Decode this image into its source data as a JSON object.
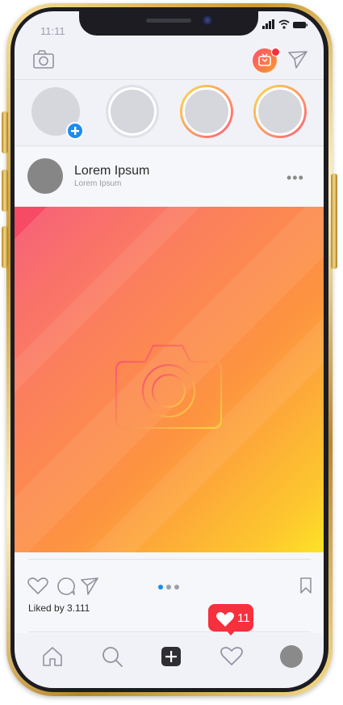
{
  "status_bar": {
    "time": "11:11"
  },
  "header": {
    "camera_icon": "camera-icon",
    "igtv_icon": "igtv-icon",
    "direct_icon": "paper-plane-icon"
  },
  "stories": {
    "add_icon": "plus-icon",
    "count": 4
  },
  "post": {
    "user_name": "Lorem Ipsum",
    "user_subtitle": "Lorem Ipsum",
    "more_label": "•••",
    "placeholder_icon": "camera-outline-icon",
    "carousel_dots": 3,
    "carousel_active": 0,
    "likes_text": "Liked by 3.111"
  },
  "notification": {
    "count": "11"
  },
  "tab_bar": {
    "items": [
      "home-icon",
      "search-icon",
      "add-post-icon",
      "heart-icon",
      "profile-avatar"
    ]
  },
  "colors": {
    "accent_blue": "#1b8cf1",
    "notif_red": "#f6303c",
    "gold": "#c99a2e"
  }
}
